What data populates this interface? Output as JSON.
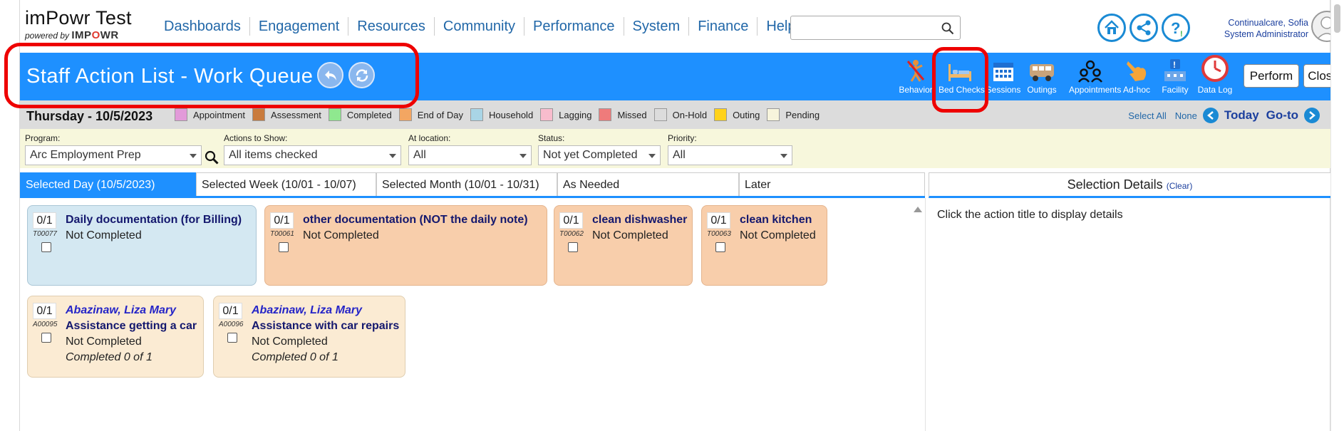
{
  "brand": {
    "title": "imPowr Test",
    "powered_by": "powered by",
    "logo_text_a": "IMP",
    "logo_text_o": "O",
    "logo_text_b": "WR"
  },
  "nav": [
    "Dashboards",
    "Engagement",
    "Resources",
    "Community",
    "Performance",
    "System",
    "Finance",
    "Help"
  ],
  "search": {
    "value": "",
    "placeholder": ""
  },
  "header_icons": [
    "home-icon",
    "share-icon",
    "help-icon"
  ],
  "user": {
    "name": "Continualcare, Sofia",
    "role": "System Administrator"
  },
  "page": {
    "title": "Staff Action List - Work Queue"
  },
  "toolbar": {
    "tools": [
      {
        "label": "Behavior",
        "icon": "behavior-icon"
      },
      {
        "label": "Bed Checks",
        "icon": "bed-icon"
      },
      {
        "label": "Sessions",
        "icon": "calendar-icon"
      },
      {
        "label": "Outings",
        "icon": "van-icon"
      },
      {
        "label": "Appointments",
        "icon": "people-icon"
      },
      {
        "label": "Ad-hoc",
        "icon": "hand-icon"
      },
      {
        "label": "Facility",
        "icon": "facility-icon"
      },
      {
        "label": "Data Log",
        "icon": "clock-icon"
      }
    ],
    "perform_label": "Perform",
    "close_label": "Close"
  },
  "datebar": {
    "date": "Thursday - 10/5/2023",
    "legend": [
      {
        "label": "Appointment",
        "color": "#e29ad9"
      },
      {
        "label": "Assessment",
        "color": "#c97b3d"
      },
      {
        "label": "Completed",
        "color": "#8fe88f"
      },
      {
        "label": "End of Day",
        "color": "#f3a662"
      },
      {
        "label": "Household",
        "color": "#a9d5e6"
      },
      {
        "label": "Lagging",
        "color": "#f8bccd"
      },
      {
        "label": "Missed",
        "color": "#ef7b7b"
      },
      {
        "label": "On-Hold",
        "color": "#dcdcdc"
      },
      {
        "label": "Outing",
        "color": "#ffd21a"
      },
      {
        "label": "Pending",
        "color": "#f7f4dc"
      }
    ],
    "select_all": "Select All",
    "none": "None",
    "today": "Today",
    "goto": "Go-to"
  },
  "filters": {
    "program": {
      "label": "Program:",
      "value": "Arc Employment Prep"
    },
    "actions": {
      "label": "Actions to Show:",
      "value": "All items checked"
    },
    "location": {
      "label": "At location:",
      "value": "All"
    },
    "status": {
      "label": "Status:",
      "value": "Not yet Completed"
    },
    "priority": {
      "label": "Priority:",
      "value": "All"
    }
  },
  "tabs": [
    "Selected Day (10/5/2023)",
    "Selected Week (10/01 - 10/07)",
    "Selected Month (10/01 - 10/31)",
    "As Needed",
    "Later"
  ],
  "details": {
    "title": "Selection Details",
    "clear": "(Clear)",
    "hint": "Click the action title to display details"
  },
  "cards": [
    {
      "count": "0/1",
      "code": "T00077",
      "title": "Daily documentation (for Billing)",
      "status": "Not Completed"
    },
    {
      "count": "0/1",
      "code": "T00061",
      "title": "other documentation (NOT the daily note)",
      "status": "Not Completed"
    },
    {
      "count": "0/1",
      "code": "T00062",
      "title": "clean dishwasher",
      "status": "Not Completed"
    },
    {
      "count": "0/1",
      "code": "T00063",
      "title": "clean kitchen",
      "status": "Not Completed"
    },
    {
      "count": "0/1",
      "code": "A00095",
      "person": "Abazinaw, Liza Mary",
      "title": "Assistance getting a car",
      "status": "Not Completed",
      "progress": "Completed 0 of 1"
    },
    {
      "count": "0/1",
      "code": "A00096",
      "person": "Abazinaw, Liza Mary",
      "title": "Assistance with car repairs",
      "status": "Not Completed",
      "progress": "Completed 0 of 1"
    }
  ]
}
